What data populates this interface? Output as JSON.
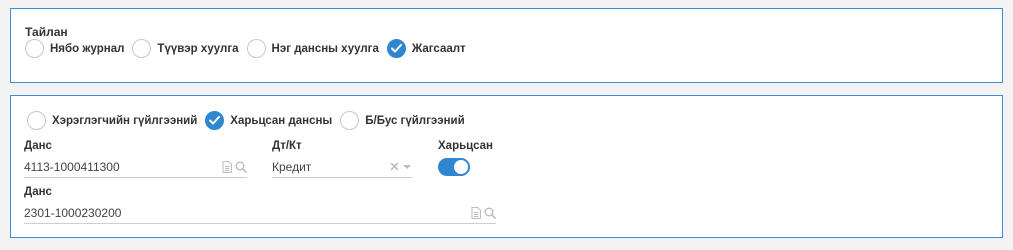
{
  "report": {
    "title": "Тайлан",
    "options": [
      {
        "label": "Нябо журнал",
        "checked": false
      },
      {
        "label": "Түүвэр хуулга",
        "checked": false
      },
      {
        "label": "Нэг дансны хуулга",
        "checked": false
      },
      {
        "label": "Жагсаалт",
        "checked": true
      }
    ]
  },
  "filter": {
    "options": [
      {
        "label": "Хэрэглэгчийн гүйлгээний",
        "checked": false
      },
      {
        "label": "Харьцсан дансны",
        "checked": true
      },
      {
        "label": "Б/Бус гүйлгээний",
        "checked": false
      }
    ],
    "account1": {
      "label": "Данс",
      "value": "4113-1000411300"
    },
    "dtkt": {
      "label": "Дт/Кт",
      "value": "Кредит"
    },
    "related": {
      "label": "Харьцсан",
      "on": true
    },
    "account2": {
      "label": "Данс",
      "value": "2301-1000230200"
    }
  },
  "icons": {
    "checked": "check-icon",
    "document": "document-icon",
    "search": "search-icon",
    "clear": "clear-icon",
    "dropdown": "chevron-down-icon"
  },
  "colors": {
    "accent": "#2f86d1",
    "border": "#3a8fd6"
  }
}
